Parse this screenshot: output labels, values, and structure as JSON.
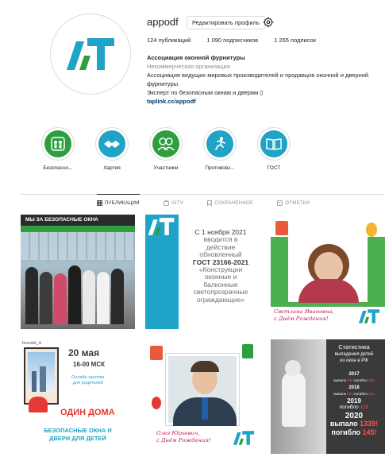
{
  "profile": {
    "username": "appodf",
    "edit_button": "Редактировать профиль",
    "stats": {
      "posts": "124 публикаций",
      "followers": "1 090 подписчиков",
      "following": "1 265 подписок"
    },
    "bio": {
      "name": "Ассоциация оконной фурнитуры",
      "category": "Некоммерческая организация",
      "description": "Ассоциация ведущих мировых производителей и продавцов оконной и дверной фурнитуры.",
      "line2": "Эксперт по безопасным окнам и дверям ▯",
      "link": "taplink.cc/appodf"
    },
    "logo_text": "A7"
  },
  "highlights": [
    {
      "label": "Безопасно...",
      "icon": "family-icon",
      "color": "#2e9e3e"
    },
    {
      "label": "Хартия",
      "icon": "handshake-icon",
      "color": "#1fa3c6"
    },
    {
      "label": "Участники",
      "icon": "people-icon",
      "color": "#2e9e3e"
    },
    {
      "label": "Противовз...",
      "icon": "runner-icon",
      "color": "#1fa3c6"
    },
    {
      "label": "ГОСТ",
      "icon": "book-icon",
      "color": "#1fa3c6"
    }
  ],
  "tabs": [
    {
      "label": "ПУБЛИКАЦИИ",
      "icon": "grid-icon",
      "active": true
    },
    {
      "label": "IGTV",
      "icon": "igtv-icon",
      "active": false
    },
    {
      "label": "СОХРАНЕННОЕ",
      "icon": "bookmark-icon",
      "active": false
    },
    {
      "label": "ОТМЕТКИ",
      "icon": "tag-icon",
      "active": false
    }
  ],
  "posts": {
    "p1": {
      "banner": "МЫ ЗА БЕЗОПАСНЫЕ ОКНА"
    },
    "p2": {
      "line1": "С 1 ноября 2021",
      "line2": "вводится в",
      "line3": "действие",
      "line4": "обновленный",
      "line5": "ГОСТ 23166-2021",
      "line6": "«Конструкции",
      "line7": "оконные и",
      "line8": "балконные",
      "line9": "светопрозрачные",
      "line10": "ограждающие»"
    },
    "p3": {
      "line1": "Светлана Ивановна,",
      "line2": "с Днём Рождения!"
    },
    "p4": {
      "account": "bezodet_in",
      "date": "20 мая",
      "time": "16-00 МСК",
      "sub1": "Онлайн занятие",
      "sub2": "для родителей",
      "title": "ОДИН ДОМА",
      "bottom1": "БЕЗОПАСНЫЕ ОКНА И",
      "bottom2": "ДВЕРИ ДЛЯ ДЕТЕЙ"
    },
    "p5": {
      "line1": "Олег Юрьевич,",
      "line2": "с Днём Рождения!"
    },
    "p6": {
      "title1": "Статистика",
      "title2": "выпадения детей",
      "title3": "из окон в РФ",
      "y2017": "2017",
      "r2017a": "выпало ",
      "r2017b": "346",
      "r2017c": " погибло ",
      "r2017d": "106",
      "y2018": "2018",
      "r2018a": "выпало ",
      "r2018b": "905",
      "r2018c": " погибло ",
      "r2018d": "123",
      "y2019": "2019",
      "r2019a": "погибло ",
      "r2019b": "125",
      "y2020": "2020",
      "r2020a": "выпало ",
      "r2020b": "1339!",
      "r2020c": "погибло ",
      "r2020d": "145!"
    }
  }
}
